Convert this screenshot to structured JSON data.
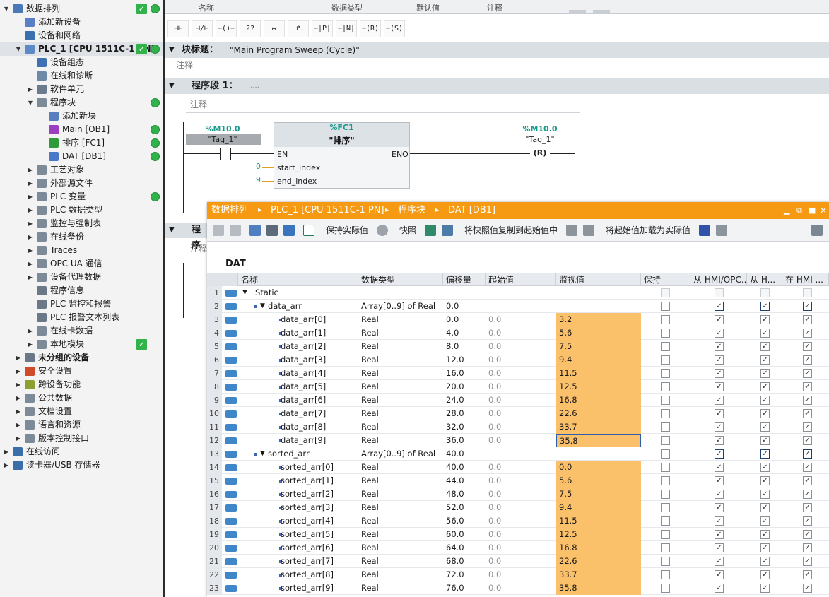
{
  "tree": {
    "items": [
      {
        "label": "数据排列",
        "level": 0,
        "arrow": "▼",
        "icon": "project-icon",
        "check": true,
        "dot": true,
        "bold": false
      },
      {
        "label": "添加新设备",
        "level": 1,
        "arrow": "",
        "icon": "add-device-icon",
        "check": false,
        "dot": false
      },
      {
        "label": "设备和网络",
        "level": 1,
        "arrow": "",
        "icon": "network-icon",
        "check": false,
        "dot": false
      },
      {
        "label": "PLC_1 [CPU 1511C-1 PN]",
        "level": 1,
        "arrow": "▼",
        "icon": "plc-icon",
        "check": true,
        "dot": true,
        "bold": true,
        "selected": true
      },
      {
        "label": "设备组态",
        "level": 2,
        "arrow": "",
        "icon": "device-config-icon",
        "check": false,
        "dot": false
      },
      {
        "label": "在线和诊断",
        "level": 2,
        "arrow": "",
        "icon": "online-diagnostics-icon",
        "check": false,
        "dot": false
      },
      {
        "label": "软件单元",
        "level": 2,
        "arrow": "▶",
        "icon": "software-unit-icon",
        "check": false,
        "dot": false
      },
      {
        "label": "程序块",
        "level": 2,
        "arrow": "▼",
        "icon": "folder-icon",
        "check": false,
        "dot": true
      },
      {
        "label": "添加新块",
        "level": 3,
        "arrow": "",
        "icon": "add-block-icon",
        "check": false,
        "dot": false
      },
      {
        "label": "Main [OB1]",
        "level": 3,
        "arrow": "",
        "icon": "ob-icon",
        "check": false,
        "dot": true
      },
      {
        "label": "排序 [FC1]",
        "level": 3,
        "arrow": "",
        "icon": "fc-icon",
        "check": false,
        "dot": true
      },
      {
        "label": "DAT [DB1]",
        "level": 3,
        "arrow": "",
        "icon": "db-icon",
        "check": false,
        "dot": true
      },
      {
        "label": "工艺对象",
        "level": 2,
        "arrow": "▶",
        "icon": "folder-icon",
        "check": false,
        "dot": false
      },
      {
        "label": "外部源文件",
        "level": 2,
        "arrow": "▶",
        "icon": "folder-icon",
        "check": false,
        "dot": false
      },
      {
        "label": "PLC 变量",
        "level": 2,
        "arrow": "▶",
        "icon": "folder-icon",
        "check": false,
        "dot": true
      },
      {
        "label": "PLC 数据类型",
        "level": 2,
        "arrow": "▶",
        "icon": "folder-icon",
        "check": false,
        "dot": false
      },
      {
        "label": "监控与强制表",
        "level": 2,
        "arrow": "▶",
        "icon": "folder-icon",
        "check": false,
        "dot": false
      },
      {
        "label": "在线备份",
        "level": 2,
        "arrow": "▶",
        "icon": "folder-icon",
        "check": false,
        "dot": false
      },
      {
        "label": "Traces",
        "level": 2,
        "arrow": "▶",
        "icon": "folder-icon",
        "check": false,
        "dot": false
      },
      {
        "label": "OPC UA 通信",
        "level": 2,
        "arrow": "▶",
        "icon": "folder-icon",
        "check": false,
        "dot": false
      },
      {
        "label": "设备代理数据",
        "level": 2,
        "arrow": "▶",
        "icon": "folder-icon",
        "check": false,
        "dot": false
      },
      {
        "label": "程序信息",
        "level": 2,
        "arrow": "",
        "icon": "program-info-icon",
        "check": false,
        "dot": false
      },
      {
        "label": "PLC 监控和报警",
        "level": 2,
        "arrow": "",
        "icon": "alarm-icon",
        "check": false,
        "dot": false
      },
      {
        "label": "PLC 报警文本列表",
        "level": 2,
        "arrow": "",
        "icon": "alarm-text-icon",
        "check": false,
        "dot": false
      },
      {
        "label": "在线卡数据",
        "level": 2,
        "arrow": "▶",
        "icon": "folder-icon",
        "check": false,
        "dot": false
      },
      {
        "label": "本地模块",
        "level": 2,
        "arrow": "▶",
        "icon": "folder-icon",
        "check": true,
        "dot": false
      },
      {
        "label": "未分组的设备",
        "level": 1,
        "arrow": "▶",
        "icon": "devices-icon",
        "check": false,
        "dot": false,
        "bold": true
      },
      {
        "label": "安全设置",
        "level": 1,
        "arrow": "▶",
        "icon": "security-icon",
        "check": false,
        "dot": false
      },
      {
        "label": "跨设备功能",
        "level": 1,
        "arrow": "▶",
        "icon": "cross-device-icon",
        "check": false,
        "dot": false
      },
      {
        "label": "公共数据",
        "level": 1,
        "arrow": "▶",
        "icon": "folder-icon",
        "check": false,
        "dot": false
      },
      {
        "label": "文档设置",
        "level": 1,
        "arrow": "▶",
        "icon": "folder-icon",
        "check": false,
        "dot": false
      },
      {
        "label": "语言和资源",
        "level": 1,
        "arrow": "▶",
        "icon": "folder-icon",
        "check": false,
        "dot": false
      },
      {
        "label": "版本控制接口",
        "level": 1,
        "arrow": "▶",
        "icon": "folder-icon",
        "check": false,
        "dot": false
      },
      {
        "label": "在线访问",
        "level": 0,
        "arrow": "▶",
        "icon": "online-access-icon",
        "check": false,
        "dot": false
      },
      {
        "label": "读卡器/USB 存储器",
        "level": 0,
        "arrow": "▶",
        "icon": "card-reader-icon",
        "check": false,
        "dot": false
      }
    ]
  },
  "editor": {
    "interface_headers": [
      "名称",
      "数据类型",
      "默认值",
      "注释"
    ],
    "ladder_buttons": [
      "⊣⊢",
      "⊣/⊢",
      "−()−",
      "??",
      "↦",
      "↱",
      "−|P|−",
      "−|N|−",
      "−(R)−",
      "−(S)−"
    ],
    "block_title_label": "块标题：",
    "block_title_value": "\"Main Program Sweep (Cycle)\"",
    "comment_label": "注释",
    "network1_label": "程序段 1：",
    "network1_dots": ".....",
    "network2_label": "程序",
    "contact_addr": "%M10.0",
    "contact_tag": "\"Tag_1\"",
    "fc_addr": "%FC1",
    "fc_name": "\"排序\"",
    "en_label": "EN",
    "eno_label": "ENO",
    "param1": "start_index",
    "param1_val": "0",
    "param2": "end_index",
    "param2_val": "9",
    "coil_addr": "%M10.0",
    "coil_tag": "\"Tag_1\"",
    "coil_symbol": "R"
  },
  "db_window": {
    "title_parts": [
      "数据排列",
      "PLC_1 [CPU 1511C-1 PN]",
      "程序块",
      "DAT [DB1]"
    ],
    "title_sep": "▸",
    "window_controls": [
      "▁",
      "⧉",
      "■",
      "✕"
    ],
    "toolbar": {
      "keep_actual": "保持实际值",
      "snapshot": "快照",
      "copy_snapshot": "将快照值复制到起始值中",
      "load_start": "将起始值加载为实际值"
    },
    "db_name": "DAT",
    "headers": [
      "名称",
      "数据类型",
      "偏移量",
      "起始值",
      "监视值",
      "保持",
      "从 HMI/OPC...",
      "从 H...",
      "在 HMI ..."
    ],
    "rows": [
      {
        "n": "1",
        "name": "Static",
        "indent": 0,
        "tri": "▼",
        "sq": false,
        "type": "",
        "offset": "",
        "start": "",
        "mon": "",
        "chk": "dis",
        "hmi": [
          "dis",
          "dis",
          "dis"
        ]
      },
      {
        "n": "2",
        "name": "data_arr",
        "indent": 1,
        "tri": "▼",
        "sq": true,
        "type": "Array[0..9] of Real",
        "offset": "0.0",
        "start": "",
        "mon": "",
        "chk": "off",
        "hmi": [
          "blue",
          "blue",
          "blue"
        ]
      },
      {
        "n": "3",
        "name": "data_arr[0]",
        "indent": 2,
        "tri": "",
        "sq": true,
        "type": "Real",
        "offset": "0.0",
        "start": "0.0",
        "mon": "3.2",
        "chk": "off",
        "hmi": [
          "on",
          "on",
          "on"
        ]
      },
      {
        "n": "4",
        "name": "data_arr[1]",
        "indent": 2,
        "tri": "",
        "sq": true,
        "type": "Real",
        "offset": "4.0",
        "start": "0.0",
        "mon": "5.6",
        "chk": "off",
        "hmi": [
          "on",
          "on",
          "on"
        ]
      },
      {
        "n": "5",
        "name": "data_arr[2]",
        "indent": 2,
        "tri": "",
        "sq": true,
        "type": "Real",
        "offset": "8.0",
        "start": "0.0",
        "mon": "7.5",
        "chk": "off",
        "hmi": [
          "on",
          "on",
          "on"
        ]
      },
      {
        "n": "6",
        "name": "data_arr[3]",
        "indent": 2,
        "tri": "",
        "sq": true,
        "type": "Real",
        "offset": "12.0",
        "start": "0.0",
        "mon": "9.4",
        "chk": "off",
        "hmi": [
          "on",
          "on",
          "on"
        ]
      },
      {
        "n": "7",
        "name": "data_arr[4]",
        "indent": 2,
        "tri": "",
        "sq": true,
        "type": "Real",
        "offset": "16.0",
        "start": "0.0",
        "mon": "11.5",
        "chk": "off",
        "hmi": [
          "on",
          "on",
          "on"
        ]
      },
      {
        "n": "8",
        "name": "data_arr[5]",
        "indent": 2,
        "tri": "",
        "sq": true,
        "type": "Real",
        "offset": "20.0",
        "start": "0.0",
        "mon": "12.5",
        "chk": "off",
        "hmi": [
          "on",
          "on",
          "on"
        ]
      },
      {
        "n": "9",
        "name": "data_arr[6]",
        "indent": 2,
        "tri": "",
        "sq": true,
        "type": "Real",
        "offset": "24.0",
        "start": "0.0",
        "mon": "16.8",
        "chk": "off",
        "hmi": [
          "on",
          "on",
          "on"
        ]
      },
      {
        "n": "10",
        "name": "data_arr[7]",
        "indent": 2,
        "tri": "",
        "sq": true,
        "type": "Real",
        "offset": "28.0",
        "start": "0.0",
        "mon": "22.6",
        "chk": "off",
        "hmi": [
          "on",
          "on",
          "on"
        ]
      },
      {
        "n": "11",
        "name": "data_arr[8]",
        "indent": 2,
        "tri": "",
        "sq": true,
        "type": "Real",
        "offset": "32.0",
        "start": "0.0",
        "mon": "33.7",
        "chk": "off",
        "hmi": [
          "on",
          "on",
          "on"
        ]
      },
      {
        "n": "12",
        "name": "data_arr[9]",
        "indent": 2,
        "tri": "",
        "sq": true,
        "type": "Real",
        "offset": "36.0",
        "start": "0.0",
        "mon": "35.8",
        "chk": "off",
        "hmi": [
          "on",
          "on",
          "on"
        ],
        "focus": true
      },
      {
        "n": "13",
        "name": "sorted_arr",
        "indent": 1,
        "tri": "▼",
        "sq": true,
        "type": "Array[0..9] of Real",
        "offset": "40.0",
        "start": "",
        "mon": "",
        "chk": "off",
        "hmi": [
          "blue",
          "blue",
          "blue"
        ]
      },
      {
        "n": "14",
        "name": "sorted_arr[0]",
        "indent": 2,
        "tri": "",
        "sq": true,
        "type": "Real",
        "offset": "40.0",
        "start": "0.0",
        "mon": "0.0",
        "chk": "off",
        "hmi": [
          "on",
          "on",
          "on"
        ]
      },
      {
        "n": "15",
        "name": "sorted_arr[1]",
        "indent": 2,
        "tri": "",
        "sq": true,
        "type": "Real",
        "offset": "44.0",
        "start": "0.0",
        "mon": "5.6",
        "chk": "off",
        "hmi": [
          "on",
          "on",
          "on"
        ]
      },
      {
        "n": "16",
        "name": "sorted_arr[2]",
        "indent": 2,
        "tri": "",
        "sq": true,
        "type": "Real",
        "offset": "48.0",
        "start": "0.0",
        "mon": "7.5",
        "chk": "off",
        "hmi": [
          "on",
          "on",
          "on"
        ]
      },
      {
        "n": "17",
        "name": "sorted_arr[3]",
        "indent": 2,
        "tri": "",
        "sq": true,
        "type": "Real",
        "offset": "52.0",
        "start": "0.0",
        "mon": "9.4",
        "chk": "off",
        "hmi": [
          "on",
          "on",
          "on"
        ]
      },
      {
        "n": "18",
        "name": "sorted_arr[4]",
        "indent": 2,
        "tri": "",
        "sq": true,
        "type": "Real",
        "offset": "56.0",
        "start": "0.0",
        "mon": "11.5",
        "chk": "off",
        "hmi": [
          "on",
          "on",
          "on"
        ]
      },
      {
        "n": "19",
        "name": "sorted_arr[5]",
        "indent": 2,
        "tri": "",
        "sq": true,
        "type": "Real",
        "offset": "60.0",
        "start": "0.0",
        "mon": "12.5",
        "chk": "off",
        "hmi": [
          "on",
          "on",
          "on"
        ]
      },
      {
        "n": "20",
        "name": "sorted_arr[6]",
        "indent": 2,
        "tri": "",
        "sq": true,
        "type": "Real",
        "offset": "64.0",
        "start": "0.0",
        "mon": "16.8",
        "chk": "off",
        "hmi": [
          "on",
          "on",
          "on"
        ]
      },
      {
        "n": "21",
        "name": "sorted_arr[7]",
        "indent": 2,
        "tri": "",
        "sq": true,
        "type": "Real",
        "offset": "68.0",
        "start": "0.0",
        "mon": "22.6",
        "chk": "off",
        "hmi": [
          "on",
          "on",
          "on"
        ]
      },
      {
        "n": "22",
        "name": "sorted_arr[8]",
        "indent": 2,
        "tri": "",
        "sq": true,
        "type": "Real",
        "offset": "72.0",
        "start": "0.0",
        "mon": "33.7",
        "chk": "off",
        "hmi": [
          "on",
          "on",
          "on"
        ]
      },
      {
        "n": "23",
        "name": "sorted_arr[9]",
        "indent": 2,
        "tri": "",
        "sq": true,
        "type": "Real",
        "offset": "76.0",
        "start": "0.0",
        "mon": "35.8",
        "chk": "off",
        "hmi": [
          "on",
          "on",
          "on"
        ]
      }
    ]
  },
  "colors": {
    "title_bar": "#f59a12",
    "monitor_cell": "#fbc06a",
    "status_green": "#2fb34a",
    "address_teal": "#1a9a8c"
  }
}
